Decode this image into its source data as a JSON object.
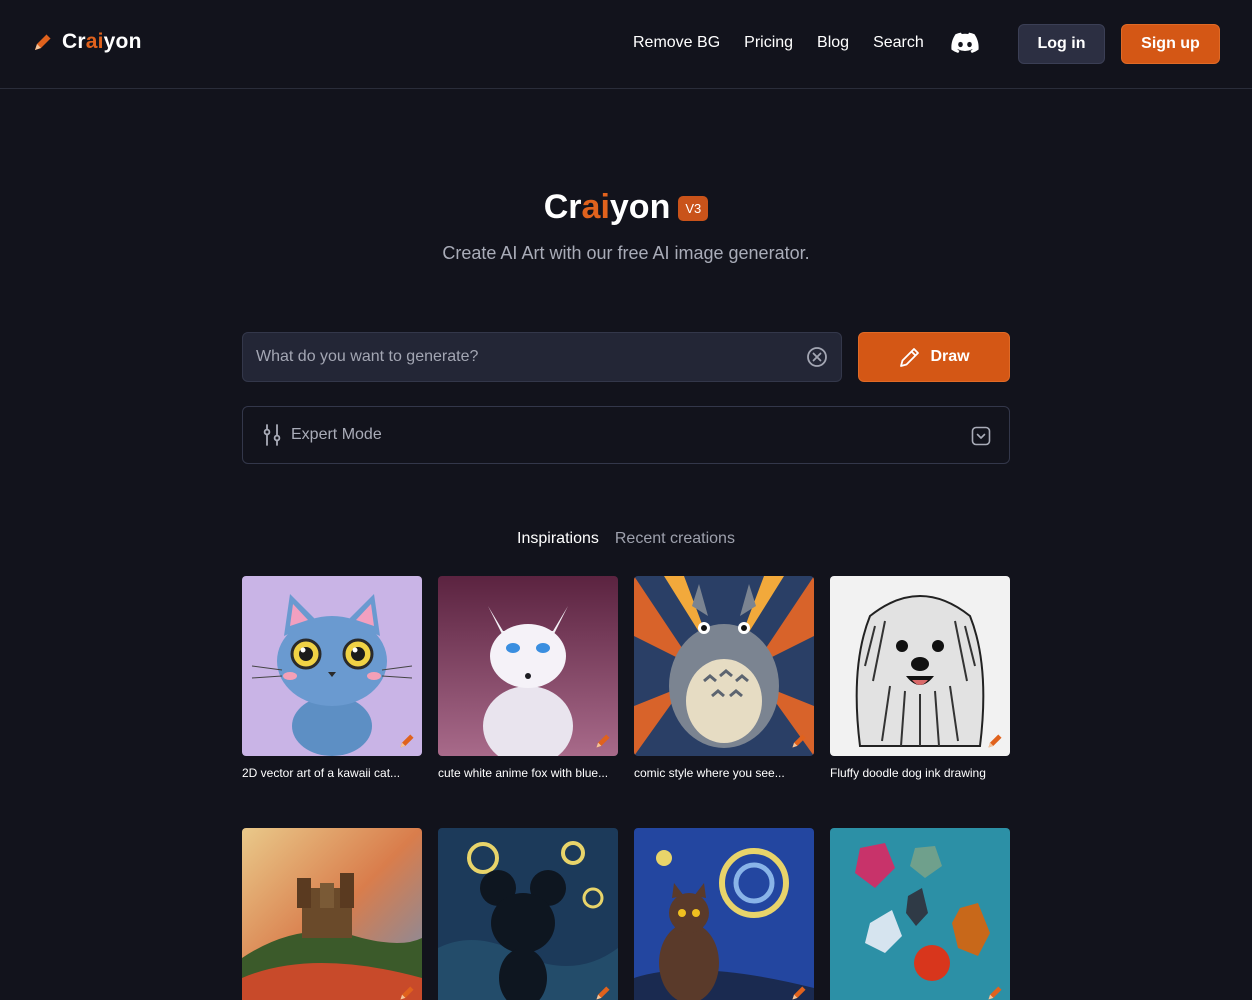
{
  "header": {
    "logo": {
      "pre": "Cr",
      "mid": "ai",
      "post": "yon"
    },
    "nav": [
      "Remove BG",
      "Pricing",
      "Blog",
      "Search"
    ],
    "login_label": "Log in",
    "signup_label": "Sign up"
  },
  "hero": {
    "title": {
      "pre": "Cr",
      "mid": "ai",
      "post": "yon"
    },
    "badge": "V3",
    "subtitle": "Create AI Art with our free AI image generator."
  },
  "prompt": {
    "placeholder": "What do you want to generate?",
    "value": "",
    "draw_label": "Draw"
  },
  "expert": {
    "label": "Expert Mode"
  },
  "tabs": {
    "inspirations": "Inspirations",
    "recent": "Recent creations"
  },
  "gallery": [
    {
      "caption": "2D vector art of a kawaii cat..."
    },
    {
      "caption": "cute white anime fox with blue..."
    },
    {
      "caption": "comic style where you see..."
    },
    {
      "caption": "Fluffy doodle dog ink drawing"
    },
    {
      "caption": ""
    },
    {
      "caption": ""
    },
    {
      "caption": ""
    },
    {
      "caption": ""
    }
  ],
  "colors": {
    "accent": "#d45715",
    "background": "#12131c",
    "input": "#232636"
  }
}
